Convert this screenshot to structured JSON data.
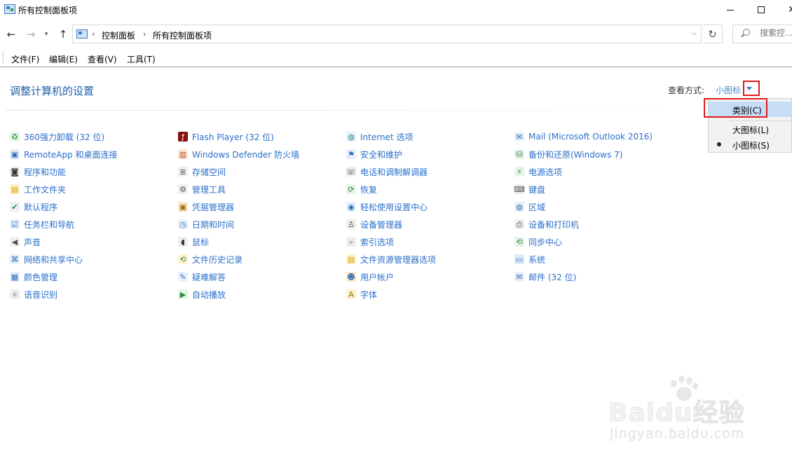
{
  "window": {
    "title": "所有控制面板项"
  },
  "address": {
    "crumbs": [
      "控制面板",
      "所有控制面板项"
    ],
    "search_placeholder": "搜索控..."
  },
  "menu": [
    "文件(F)",
    "编辑(E)",
    "查看(V)",
    "工具(T)"
  ],
  "header": {
    "title": "调整计算机的设置",
    "view_by_label": "查看方式:",
    "view_by_value": "小图标"
  },
  "dropdown": {
    "options": [
      {
        "label": "类别(C)",
        "highlighted": true,
        "selected": false
      },
      {
        "label": "大图标(L)",
        "highlighted": false,
        "selected": false
      },
      {
        "label": "小图标(S)",
        "highlighted": false,
        "selected": true
      }
    ]
  },
  "columns": [
    [
      {
        "label": "360强力卸载 (32 位)",
        "icon": "uninstall-icon"
      },
      {
        "label": "RemoteApp 和桌面连接",
        "icon": "remote-desktop-icon"
      },
      {
        "label": "程序和功能",
        "icon": "programs-icon"
      },
      {
        "label": "工作文件夹",
        "icon": "work-folders-icon"
      },
      {
        "label": "默认程序",
        "icon": "default-programs-icon"
      },
      {
        "label": "任务栏和导航",
        "icon": "taskbar-icon"
      },
      {
        "label": "声音",
        "icon": "sound-icon"
      },
      {
        "label": "网络和共享中心",
        "icon": "network-icon"
      },
      {
        "label": "颜色管理",
        "icon": "color-management-icon"
      },
      {
        "label": "语音识别",
        "icon": "microphone-icon"
      }
    ],
    [
      {
        "label": "Flash Player (32 位)",
        "icon": "flash-icon"
      },
      {
        "label": "Windows Defender 防火墙",
        "icon": "firewall-icon"
      },
      {
        "label": "存储空间",
        "icon": "storage-icon"
      },
      {
        "label": "管理工具",
        "icon": "admin-tools-icon"
      },
      {
        "label": "凭据管理器",
        "icon": "credential-icon"
      },
      {
        "label": "日期和时间",
        "icon": "calendar-icon"
      },
      {
        "label": "鼠标",
        "icon": "mouse-icon"
      },
      {
        "label": "文件历史记录",
        "icon": "file-history-icon"
      },
      {
        "label": "疑难解答",
        "icon": "troubleshoot-icon"
      },
      {
        "label": "自动播放",
        "icon": "autoplay-icon"
      }
    ],
    [
      {
        "label": "Internet 选项",
        "icon": "internet-icon"
      },
      {
        "label": "安全和维护",
        "icon": "flag-icon"
      },
      {
        "label": "电话和调制解调器",
        "icon": "phone-icon"
      },
      {
        "label": "恢复",
        "icon": "recovery-icon"
      },
      {
        "label": "轻松使用设置中心",
        "icon": "ease-of-access-icon"
      },
      {
        "label": "设备管理器",
        "icon": "device-manager-icon"
      },
      {
        "label": "索引选项",
        "icon": "indexing-icon"
      },
      {
        "label": "文件资源管理器选项",
        "icon": "folder-options-icon"
      },
      {
        "label": "用户帐户",
        "icon": "users-icon"
      },
      {
        "label": "字体",
        "icon": "font-icon"
      }
    ],
    [
      {
        "label": "Mail (Microsoft Outlook 2016)",
        "icon": "mail-icon"
      },
      {
        "label": "备份和还原(Windows 7)",
        "icon": "backup-icon"
      },
      {
        "label": "电源选项",
        "icon": "power-icon"
      },
      {
        "label": "键盘",
        "icon": "keyboard-icon"
      },
      {
        "label": "区域",
        "icon": "globe-icon"
      },
      {
        "label": "设备和打印机",
        "icon": "printer-icon"
      },
      {
        "label": "同步中心",
        "icon": "sync-icon"
      },
      {
        "label": "系统",
        "icon": "system-icon"
      },
      {
        "label": "邮件 (32 位)",
        "icon": "mail-32-icon"
      }
    ]
  ],
  "colors": {
    "link": "#2a6fcb",
    "title": "#1e5fa8",
    "highlight_box": "#e01b1b",
    "dropdown_highlight": "#c6ddf5"
  }
}
